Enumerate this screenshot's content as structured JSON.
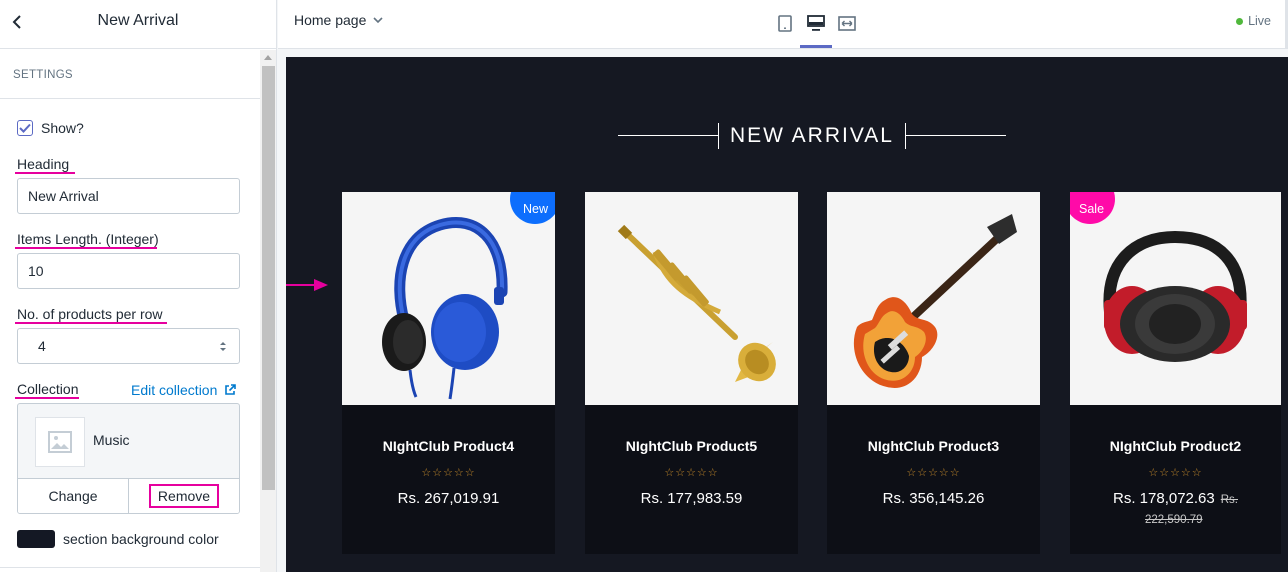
{
  "sidebar": {
    "title": "New Arrival",
    "section_label": "SETTINGS",
    "show_label": "Show?",
    "show_checked": true,
    "heading_label": "Heading",
    "heading_value": "New Arrival",
    "items_label": "Items Length. (Integer)",
    "items_value": "10",
    "per_row_label": "No. of products per row",
    "per_row_value": "4",
    "collection_label": "Collection",
    "edit_collection": "Edit collection",
    "collection_name": "Music",
    "change_btn": "Change",
    "remove_btn": "Remove",
    "bg_color_label": "section background color",
    "bg_color": "#141824"
  },
  "topbar": {
    "page": "Home page",
    "live": "Live",
    "active_view": "desktop"
  },
  "preview": {
    "heading": "NEW ARRIVAL",
    "products": [
      {
        "name": "NIghtClub Product4",
        "price": "Rs. 267,019.91",
        "badge": "New",
        "image": "headphones-blue"
      },
      {
        "name": "NIghtClub Product5",
        "price": "Rs. 177,983.59",
        "badge": "",
        "image": "trumpet"
      },
      {
        "name": "NIghtClub Product3",
        "price": "Rs. 356,145.26",
        "badge": "",
        "image": "electric-guitar"
      },
      {
        "name": "NIghtClub Product2",
        "price": "Rs. 178,072.63",
        "old_price_a": "Rs.",
        "old_price_b": "222,590.79",
        "badge": "Sale",
        "image": "headphones-red"
      }
    ],
    "stars": "☆☆☆☆☆"
  },
  "colors": {
    "accent": "#5c6ac4",
    "annotation": "#e6009e",
    "preview_bg": "#151822",
    "new_badge": "#0d6efd",
    "sale_badge": "#ff0aa8",
    "live": "#50b83c"
  }
}
